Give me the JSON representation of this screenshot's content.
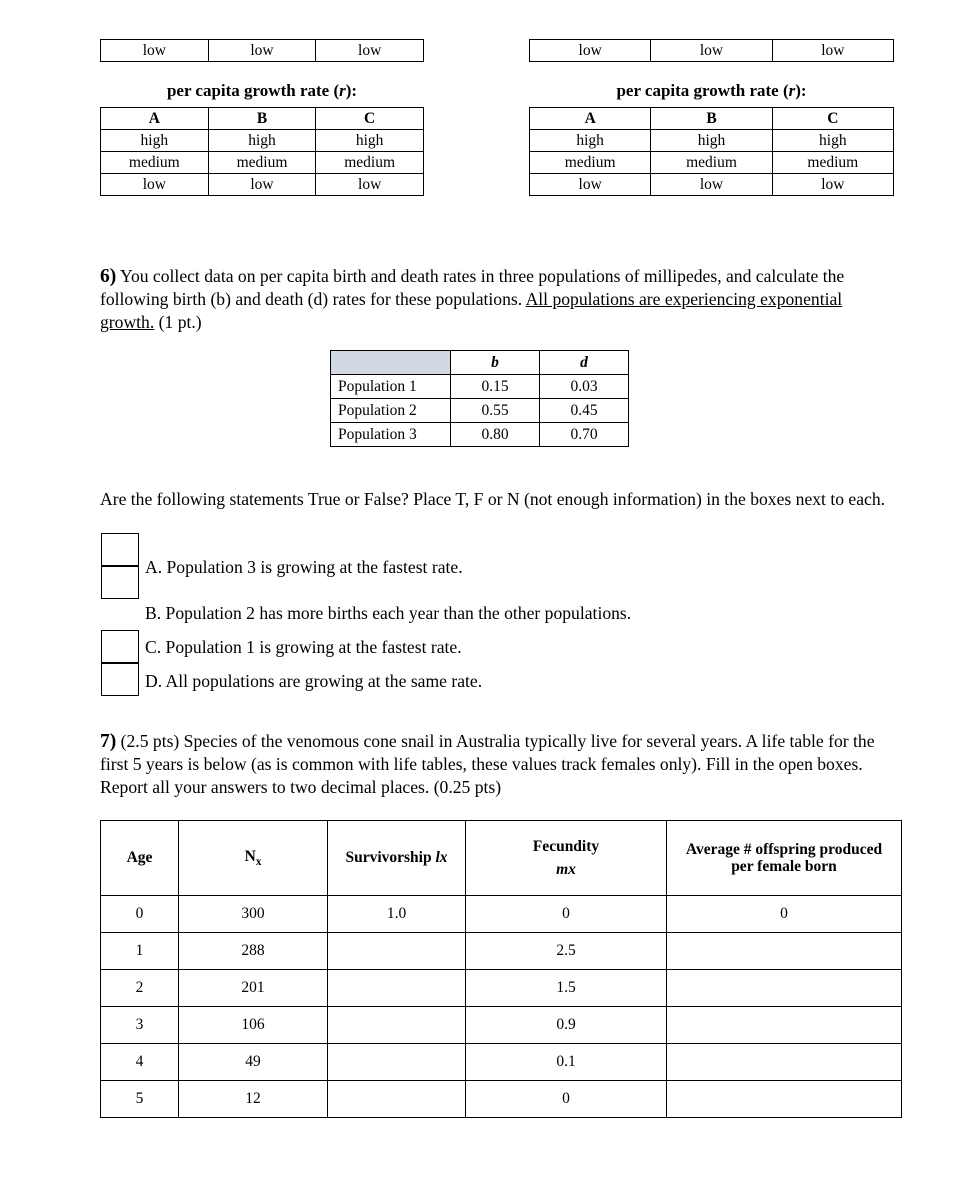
{
  "fragment_tables": {
    "row_values": [
      "low",
      "low",
      "low"
    ]
  },
  "rate_tables": {
    "title_prefix": "per capita growth rate (",
    "title_symbol": "r",
    "title_suffix": "):",
    "headers": [
      "A",
      "B",
      "C"
    ],
    "rows": [
      [
        "high",
        "high",
        "high"
      ],
      [
        "medium",
        "medium",
        "medium"
      ],
      [
        "low",
        "low",
        "low"
      ]
    ]
  },
  "question6": {
    "number": "6)",
    "text_part1": " You collect data on per capita birth and death rates in three populations of millipedes, and calculate the following birth (b) and death (d) rates for these populations. ",
    "underlined": "All populations are experiencing exponential growth.",
    "text_part2": " (1 pt.)",
    "table": {
      "corner": "",
      "headers": [
        "b",
        "d"
      ],
      "rows": [
        {
          "label": "Population 1",
          "b": "0.15",
          "d": "0.03"
        },
        {
          "label": "Population 2",
          "b": "0.55",
          "d": "0.45"
        },
        {
          "label": "Population 3",
          "b": "0.80",
          "d": "0.70"
        }
      ]
    },
    "true_false": {
      "instructions": "Are the following statements True or False?  Place T, F or N (not enough information) in the boxes next to each.",
      "items": [
        {
          "letter": "A.",
          "statement": "A.  Population 3 is growing at the fastest rate.",
          "answer": ""
        },
        {
          "letter": "B.",
          "statement": "B.  Population 2 has more births each year than the other populations.",
          "answer": ""
        },
        {
          "letter": "C.",
          "statement": "C.  Population 1 is growing at the fastest rate.",
          "answer": ""
        },
        {
          "letter": "D.",
          "statement": "D.  All populations are growing at the same rate.",
          "answer": ""
        }
      ]
    }
  },
  "question7": {
    "number": "7)",
    "text": " (2.5 pts) Species of the venomous cone snail in Australia typically live for several years.  A life table for the first 5 years is below (as is common with life tables, these values track females only). Fill in the open boxes. Report all your answers to two decimal places. (0.25 pts)",
    "life_table": {
      "headers": {
        "age": "Age",
        "nx_base": "N",
        "nx_sub": "x",
        "survivorship_label": "Survivorship ",
        "survivorship_symbol": "lx",
        "fecundity_label": "Fecundity",
        "fecundity_symbol": "mx",
        "average_line1": "Average # offspring produced",
        "average_line2": "per female born"
      },
      "rows": [
        {
          "age": "0",
          "nx": "300",
          "lx": "1.0",
          "mx": "0",
          "avg": "0"
        },
        {
          "age": "1",
          "nx": "288",
          "lx": "",
          "mx": "2.5",
          "avg": ""
        },
        {
          "age": "2",
          "nx": "201",
          "lx": "",
          "mx": "1.5",
          "avg": ""
        },
        {
          "age": "3",
          "nx": "106",
          "lx": "",
          "mx": "0.9",
          "avg": ""
        },
        {
          "age": "4",
          "nx": "49",
          "lx": "",
          "mx": "0.1",
          "avg": ""
        },
        {
          "age": "5",
          "nx": "12",
          "lx": "",
          "mx": "0",
          "avg": ""
        }
      ]
    }
  },
  "colors": {
    "bd_header_fill": "#d2d9e3",
    "life_header_fill": "#d4d4d4",
    "border": "#000000"
  }
}
